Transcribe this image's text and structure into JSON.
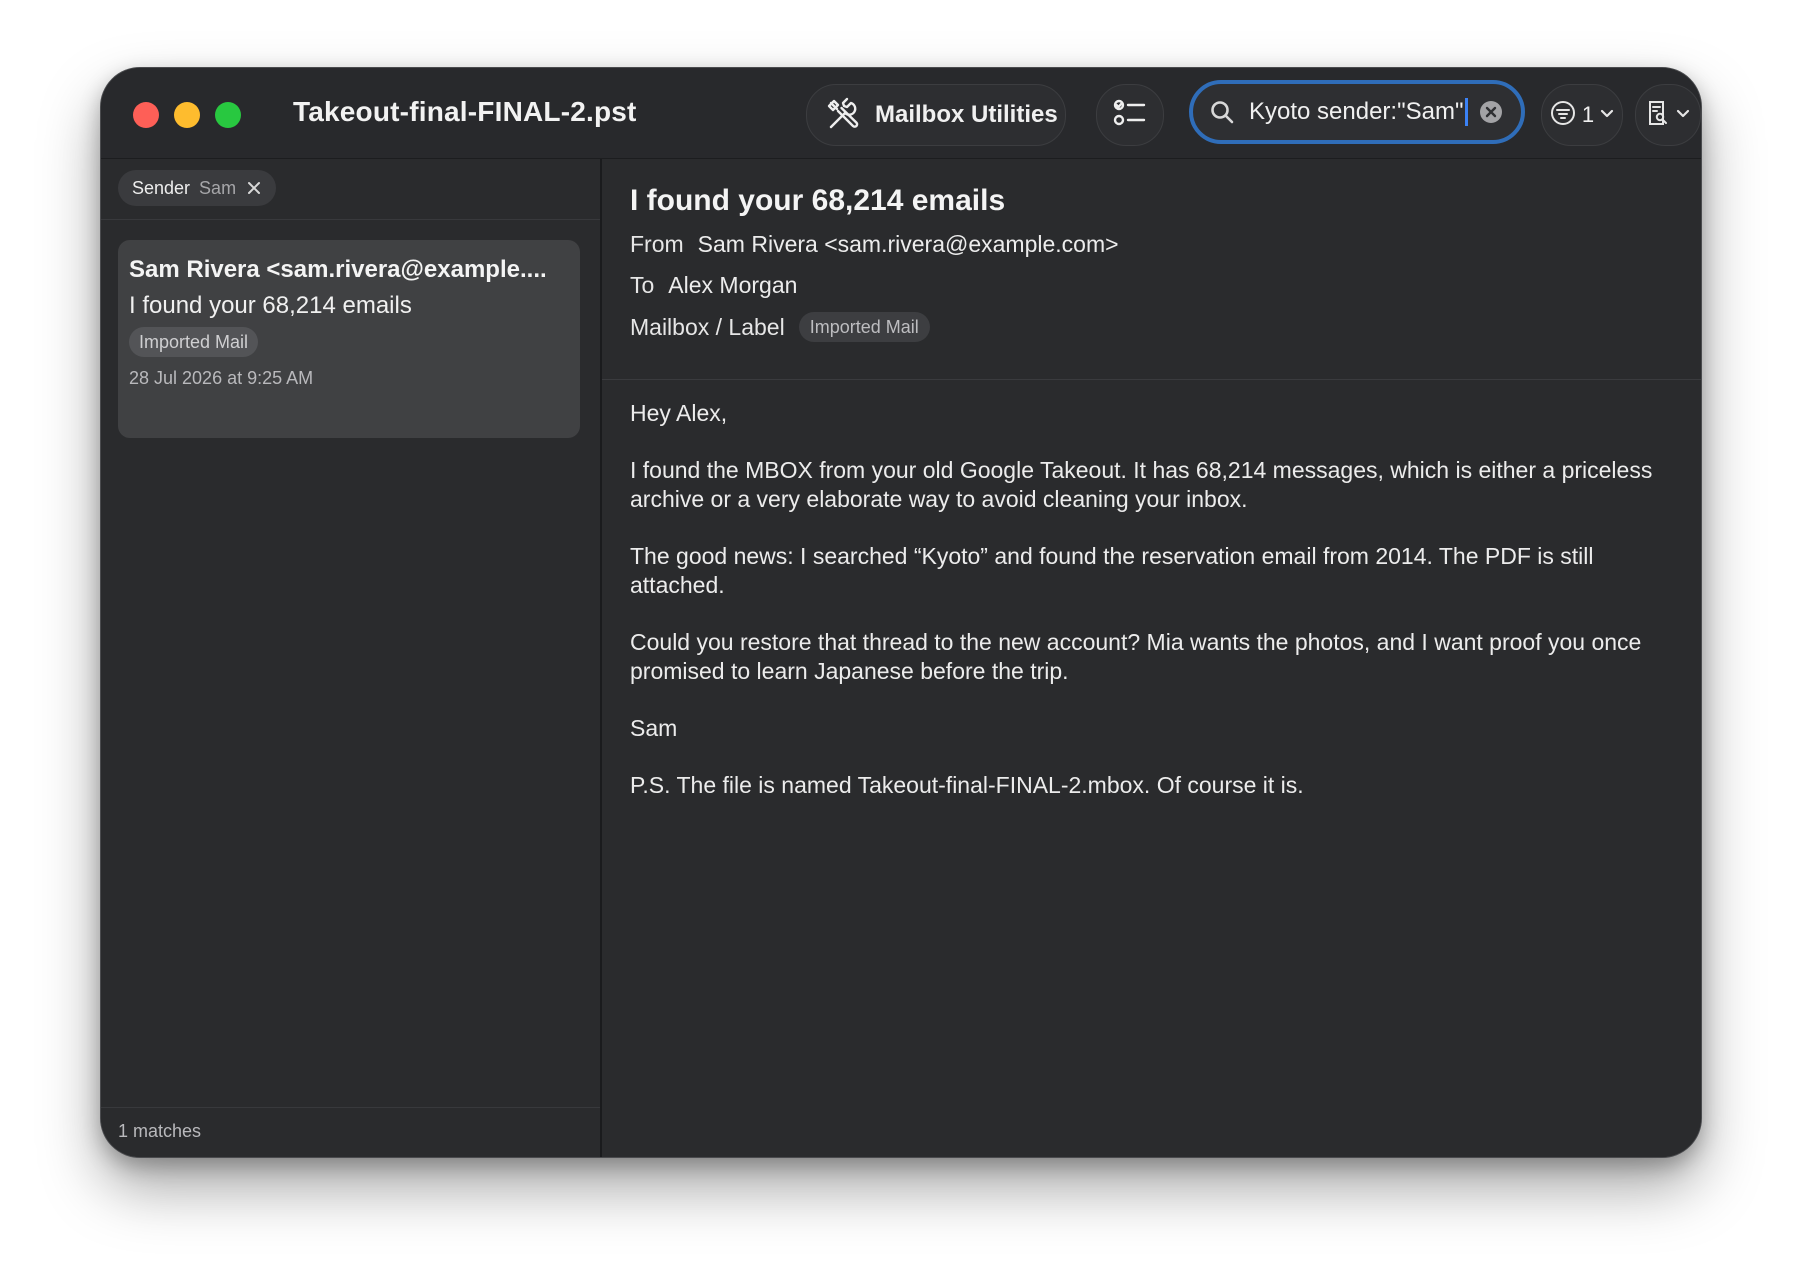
{
  "window": {
    "title": "Takeout-final-FINAL-2.pst"
  },
  "toolbar": {
    "utilities_label": "Mailbox Utilities",
    "utilities_icon": "tools-icon",
    "list_icon": "checklist-icon",
    "search_value": "Kyoto sender:\"Sam\"",
    "filter_count": "1",
    "accent_color": "#2f6db9"
  },
  "sidebar": {
    "filter_chip": {
      "key": "Sender",
      "value": "Sam"
    },
    "messages": [
      {
        "sender": "Sam Rivera <sam.rivera@example....",
        "subject": "I found your 68,214 emails",
        "label": "Imported Mail",
        "date": "28 Jul 2026 at 9:25 AM"
      }
    ],
    "match_count": "1 matches"
  },
  "reader": {
    "subject": "I found your 68,214 emails",
    "from_label": "From",
    "from_value": "Sam Rivera <sam.rivera@example.com>",
    "to_label": "To",
    "to_value": "Alex Morgan",
    "mailbox_label": "Mailbox / Label",
    "mailbox_badge": "Imported Mail",
    "body": [
      "Hey Alex,",
      "I found the MBOX from your old Google Takeout. It has 68,214 messages, which is either a priceless archive or a very elaborate way to avoid cleaning your inbox.",
      "The good news: I searched “Kyoto” and found the reservation email from 2014. The PDF is still attached.",
      "Could you restore that thread to the new account? Mia wants the photos, and I want proof you once promised to learn Japanese before the trip.",
      "Sam",
      "P.S. The file is named Takeout-final-FINAL-2.mbox. Of course it is."
    ]
  }
}
